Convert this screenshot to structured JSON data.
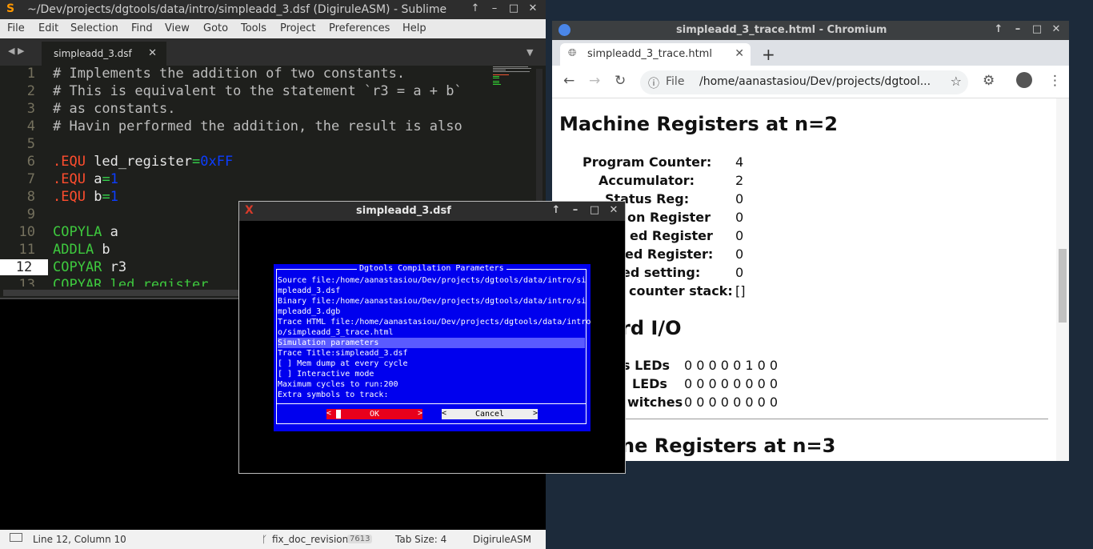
{
  "sublime": {
    "title": "~/Dev/projects/dgtools/data/intro/simpleadd_3.dsf (DigiruleASM) - Sublime",
    "menu": [
      "File",
      "Edit",
      "Selection",
      "Find",
      "View",
      "Goto",
      "Tools",
      "Project",
      "Preferences",
      "Help"
    ],
    "tab_label": "simpleadd_3.dsf",
    "line_numbers": [
      "1",
      "2",
      "3",
      "4",
      "5",
      "6",
      "7",
      "8",
      "9",
      "10",
      "11",
      "12",
      "13"
    ],
    "lines": {
      "l1": "# Implements the addition of two constants.",
      "l2": "# This is equivalent to the statement `r3 = a + b`",
      "l3": "# as constants.",
      "l4": "# Havin performed the addition, the result is also",
      "l6_kw": ".EQU",
      "l6_name": " led_register",
      "l6_eq": "=",
      "l6_val": "0xFF",
      "l7_kw": ".EQU",
      "l7_name": " a",
      "l7_eq": "=",
      "l7_val": "1",
      "l8_kw": ".EQU",
      "l8_name": " b",
      "l8_eq": "=",
      "l8_val": "1",
      "l10_ins": "COPYLA",
      "l10_arg": " a",
      "l11_ins": "ADDLA",
      "l11_arg": " b",
      "l12_ins": "COPYAR",
      "l12_arg": " r3",
      "l13": "COPYAR led_register"
    },
    "status": {
      "position": "Line 12, Column 10",
      "branch": "fix_doc_revision",
      "branch_count": "7613",
      "tab_size": "Tab Size: 4",
      "syntax": "DigiruleASM"
    }
  },
  "chromium": {
    "title": "simpleadd_3_trace.html - Chromium",
    "tab_label": "simpleadd_3_trace.html",
    "url_scheme": "File",
    "url": "/home/aanastasiou/Dev/projects/dgtool...",
    "section_n2": "Machine Registers at n=2",
    "registers": [
      {
        "label": "Program Counter:",
        "value": "4"
      },
      {
        "label": "Accumulator:",
        "value": "2"
      },
      {
        "label": "Status Reg:",
        "value": "0"
      },
      {
        "label": "on Register",
        "value": "0"
      },
      {
        "label": "ed Register",
        "value": "0"
      },
      {
        "label": "ed Register:",
        "value": "0"
      },
      {
        "label": "ed setting:",
        "value": "0"
      },
      {
        "label": "counter stack:",
        "value": "[]"
      }
    ],
    "section_io": "rd I/O",
    "io": [
      {
        "label": "s LEDs",
        "value": "0 0 0 0 0 1 0 0"
      },
      {
        "label": "LEDs",
        "value": "0 0 0 0 0 0 0 0"
      },
      {
        "label": "witches",
        "value": "0 0 0 0 0 0 0 0"
      }
    ],
    "section_n3": "ne Registers at n=3"
  },
  "dialog": {
    "title": "simpleadd_3.dsf",
    "heading": "Dgtools Compilation Parameters",
    "lines": [
      "Source file:/home/aanastasiou/Dev/projects/dgtools/data/intro/si",
      "mpleadd_3.dsf",
      "Binary file:/home/aanastasiou/Dev/projects/dgtools/data/intro/si",
      "mpleadd_3.dgb",
      "Trace HTML file:/home/aanastasiou/Dev/projects/dgtools/data/intro",
      "o/simpleadd_3_trace.html",
      "Simulation parameters",
      "Trace Title:simpleadd_3.dsf",
      "[ ] Mem dump at every cycle",
      "[ ] Interactive mode",
      "Maximum cycles to run:200",
      "Extra symbols to track:"
    ],
    "ok_label": "OK",
    "cancel_label": "Cancel"
  }
}
